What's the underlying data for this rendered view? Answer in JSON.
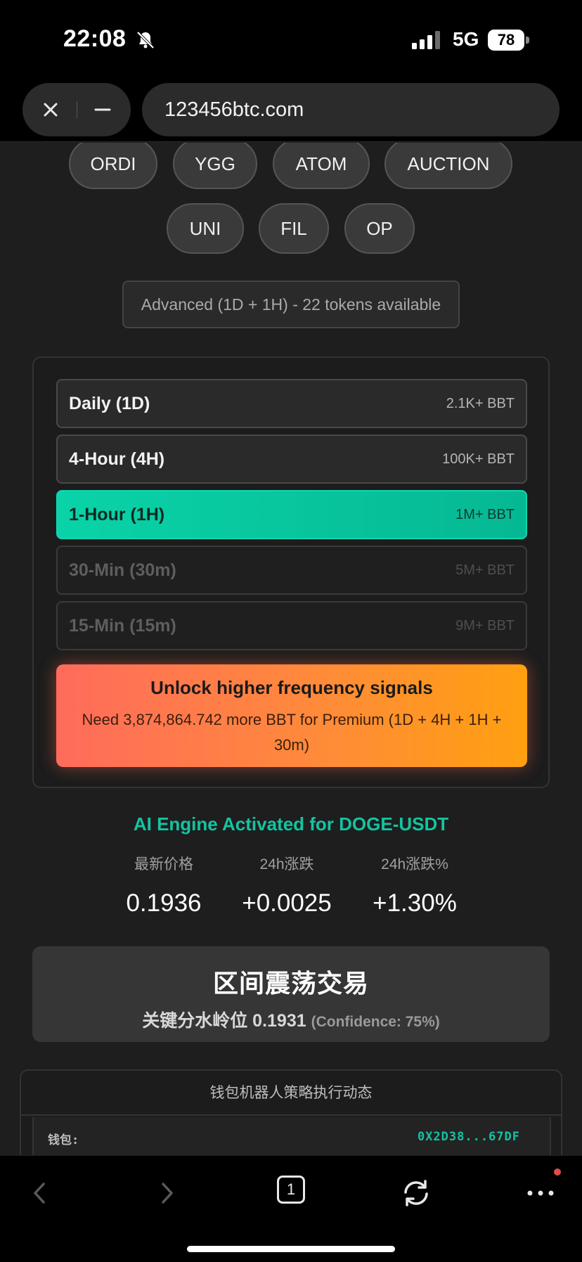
{
  "status_bar": {
    "time": "22:08",
    "network": "5G",
    "battery": "78"
  },
  "browser": {
    "url": "123456btc.com"
  },
  "tokens": {
    "row1": [
      "ORDI",
      "YGG",
      "ATOM",
      "AUCTION"
    ],
    "row2": [
      "UNI",
      "FIL",
      "OP"
    ]
  },
  "tier_label": "Advanced (1D + 1H) - 22 tokens available",
  "timeframes": [
    {
      "name": "Daily (1D)",
      "requirement": "2.1K+ BBT",
      "state": "available"
    },
    {
      "name": "4-Hour (4H)",
      "requirement": "100K+ BBT",
      "state": "available"
    },
    {
      "name": "1-Hour (1H)",
      "requirement": "1M+ BBT",
      "state": "active"
    },
    {
      "name": "30-Min (30m)",
      "requirement": "5M+ BBT",
      "state": "locked"
    },
    {
      "name": "15-Min (15m)",
      "requirement": "9M+ BBT",
      "state": "locked"
    }
  ],
  "unlock": {
    "title": "Unlock higher frequency signals",
    "description": "Need 3,874,864.742 more BBT for Premium (1D + 4H + 1H + 30m)"
  },
  "engine_title": "AI Engine Activated for DOGE-USDT",
  "stats": [
    {
      "label": "最新价格",
      "value": "0.1936"
    },
    {
      "label": "24h涨跌",
      "value": "+0.0025"
    },
    {
      "label": "24h涨跌%",
      "value": "+1.30%"
    }
  ],
  "signal": {
    "title": "区间震荡交易",
    "key_label": "关键分水岭位",
    "key_value": "0.1931",
    "confidence": "(Confidence: 75%)"
  },
  "bot": {
    "title": "钱包机器人策略执行动态",
    "wallet_label": "钱包:",
    "wallet_value": "0X2D38...67DF"
  },
  "toolbar": {
    "tab_count": "1"
  },
  "colors": {
    "accent": "#13c4a1",
    "active_tf": "#0ad3a8",
    "unlock_start": "#ff6b5c",
    "unlock_end": "#ffa010"
  }
}
